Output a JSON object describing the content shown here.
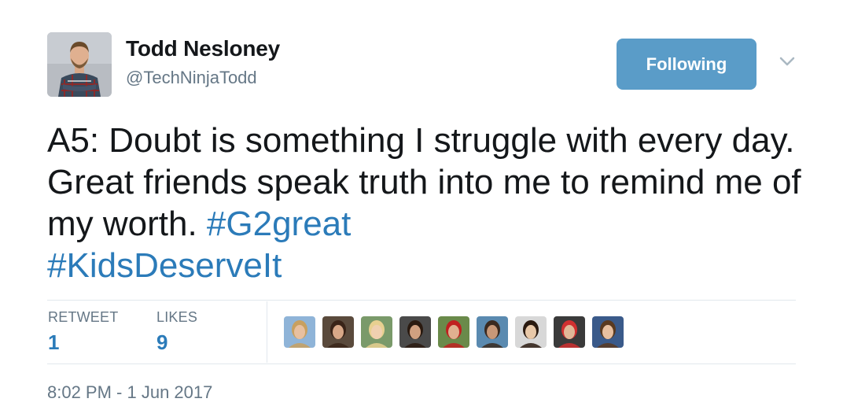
{
  "author": {
    "name": "Todd Nesloney",
    "handle": "@TechNinjaTodd",
    "avatar_icon": "profile-photo"
  },
  "follow_button": {
    "label": "Following",
    "color": "#5a9cc8"
  },
  "menu_icon": "chevron-down-icon",
  "tweet": {
    "text_plain": "A5: Doubt is something I struggle with every day.  Great friends speak truth into me to remind me of my worth. ",
    "hashtags": [
      "#G2great",
      "#KidsDeserveIt"
    ],
    "link_color": "#2b7bb9"
  },
  "stats": {
    "retweets_label": "RETWEET",
    "retweets_count": "1",
    "likes_label": "LIKES",
    "likes_count": "9"
  },
  "likers": [
    {
      "name": "liker-avatar-1",
      "bg": "#8fb4d8",
      "face": "#e8c0a0",
      "hair": "#c8a060"
    },
    {
      "name": "liker-avatar-2",
      "bg": "#5a4a3c",
      "face": "#d8a888",
      "hair": "#3a2418"
    },
    {
      "name": "liker-avatar-3",
      "bg": "#7a9a6a",
      "face": "#f0d0b0",
      "hair": "#e8d090"
    },
    {
      "name": "liker-avatar-4",
      "bg": "#4a4a4a",
      "face": "#d0a080",
      "hair": "#2a1a10"
    },
    {
      "name": "liker-avatar-5",
      "bg": "#6a8a4a",
      "face": "#e0b090",
      "hair": "#c02020"
    },
    {
      "name": "liker-avatar-6",
      "bg": "#5a8ab0",
      "face": "#c89878",
      "hair": "#3a2a20"
    },
    {
      "name": "liker-avatar-7",
      "bg": "#d8d8d8",
      "face": "#e8c8a8",
      "hair": "#2a1a10"
    },
    {
      "name": "liker-avatar-8",
      "bg": "#3a3a3a",
      "face": "#e0b898",
      "hair": "#d03030"
    },
    {
      "name": "liker-avatar-9",
      "bg": "#3a5a8a",
      "face": "#e8c0a0",
      "hair": "#5a3a20"
    }
  ],
  "timestamp": "8:02 PM - 1 Jun 2017"
}
